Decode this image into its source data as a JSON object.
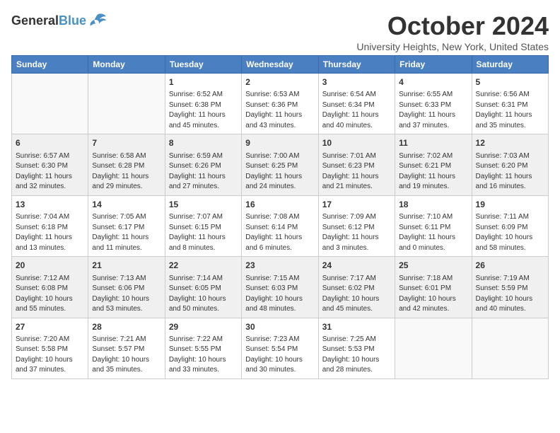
{
  "header": {
    "logo_line1": "General",
    "logo_line2": "Blue",
    "month": "October 2024",
    "location": "University Heights, New York, United States"
  },
  "weekdays": [
    "Sunday",
    "Monday",
    "Tuesday",
    "Wednesday",
    "Thursday",
    "Friday",
    "Saturday"
  ],
  "weeks": [
    [
      {
        "day": "",
        "info": ""
      },
      {
        "day": "",
        "info": ""
      },
      {
        "day": "1",
        "info": "Sunrise: 6:52 AM\nSunset: 6:38 PM\nDaylight: 11 hours\nand 45 minutes."
      },
      {
        "day": "2",
        "info": "Sunrise: 6:53 AM\nSunset: 6:36 PM\nDaylight: 11 hours\nand 43 minutes."
      },
      {
        "day": "3",
        "info": "Sunrise: 6:54 AM\nSunset: 6:34 PM\nDaylight: 11 hours\nand 40 minutes."
      },
      {
        "day": "4",
        "info": "Sunrise: 6:55 AM\nSunset: 6:33 PM\nDaylight: 11 hours\nand 37 minutes."
      },
      {
        "day": "5",
        "info": "Sunrise: 6:56 AM\nSunset: 6:31 PM\nDaylight: 11 hours\nand 35 minutes."
      }
    ],
    [
      {
        "day": "6",
        "info": "Sunrise: 6:57 AM\nSunset: 6:30 PM\nDaylight: 11 hours\nand 32 minutes."
      },
      {
        "day": "7",
        "info": "Sunrise: 6:58 AM\nSunset: 6:28 PM\nDaylight: 11 hours\nand 29 minutes."
      },
      {
        "day": "8",
        "info": "Sunrise: 6:59 AM\nSunset: 6:26 PM\nDaylight: 11 hours\nand 27 minutes."
      },
      {
        "day": "9",
        "info": "Sunrise: 7:00 AM\nSunset: 6:25 PM\nDaylight: 11 hours\nand 24 minutes."
      },
      {
        "day": "10",
        "info": "Sunrise: 7:01 AM\nSunset: 6:23 PM\nDaylight: 11 hours\nand 21 minutes."
      },
      {
        "day": "11",
        "info": "Sunrise: 7:02 AM\nSunset: 6:21 PM\nDaylight: 11 hours\nand 19 minutes."
      },
      {
        "day": "12",
        "info": "Sunrise: 7:03 AM\nSunset: 6:20 PM\nDaylight: 11 hours\nand 16 minutes."
      }
    ],
    [
      {
        "day": "13",
        "info": "Sunrise: 7:04 AM\nSunset: 6:18 PM\nDaylight: 11 hours\nand 13 minutes."
      },
      {
        "day": "14",
        "info": "Sunrise: 7:05 AM\nSunset: 6:17 PM\nDaylight: 11 hours\nand 11 minutes."
      },
      {
        "day": "15",
        "info": "Sunrise: 7:07 AM\nSunset: 6:15 PM\nDaylight: 11 hours\nand 8 minutes."
      },
      {
        "day": "16",
        "info": "Sunrise: 7:08 AM\nSunset: 6:14 PM\nDaylight: 11 hours\nand 6 minutes."
      },
      {
        "day": "17",
        "info": "Sunrise: 7:09 AM\nSunset: 6:12 PM\nDaylight: 11 hours\nand 3 minutes."
      },
      {
        "day": "18",
        "info": "Sunrise: 7:10 AM\nSunset: 6:11 PM\nDaylight: 11 hours\nand 0 minutes."
      },
      {
        "day": "19",
        "info": "Sunrise: 7:11 AM\nSunset: 6:09 PM\nDaylight: 10 hours\nand 58 minutes."
      }
    ],
    [
      {
        "day": "20",
        "info": "Sunrise: 7:12 AM\nSunset: 6:08 PM\nDaylight: 10 hours\nand 55 minutes."
      },
      {
        "day": "21",
        "info": "Sunrise: 7:13 AM\nSunset: 6:06 PM\nDaylight: 10 hours\nand 53 minutes."
      },
      {
        "day": "22",
        "info": "Sunrise: 7:14 AM\nSunset: 6:05 PM\nDaylight: 10 hours\nand 50 minutes."
      },
      {
        "day": "23",
        "info": "Sunrise: 7:15 AM\nSunset: 6:03 PM\nDaylight: 10 hours\nand 48 minutes."
      },
      {
        "day": "24",
        "info": "Sunrise: 7:17 AM\nSunset: 6:02 PM\nDaylight: 10 hours\nand 45 minutes."
      },
      {
        "day": "25",
        "info": "Sunrise: 7:18 AM\nSunset: 6:01 PM\nDaylight: 10 hours\nand 42 minutes."
      },
      {
        "day": "26",
        "info": "Sunrise: 7:19 AM\nSunset: 5:59 PM\nDaylight: 10 hours\nand 40 minutes."
      }
    ],
    [
      {
        "day": "27",
        "info": "Sunrise: 7:20 AM\nSunset: 5:58 PM\nDaylight: 10 hours\nand 37 minutes."
      },
      {
        "day": "28",
        "info": "Sunrise: 7:21 AM\nSunset: 5:57 PM\nDaylight: 10 hours\nand 35 minutes."
      },
      {
        "day": "29",
        "info": "Sunrise: 7:22 AM\nSunset: 5:55 PM\nDaylight: 10 hours\nand 33 minutes."
      },
      {
        "day": "30",
        "info": "Sunrise: 7:23 AM\nSunset: 5:54 PM\nDaylight: 10 hours\nand 30 minutes."
      },
      {
        "day": "31",
        "info": "Sunrise: 7:25 AM\nSunset: 5:53 PM\nDaylight: 10 hours\nand 28 minutes."
      },
      {
        "day": "",
        "info": ""
      },
      {
        "day": "",
        "info": ""
      }
    ]
  ]
}
